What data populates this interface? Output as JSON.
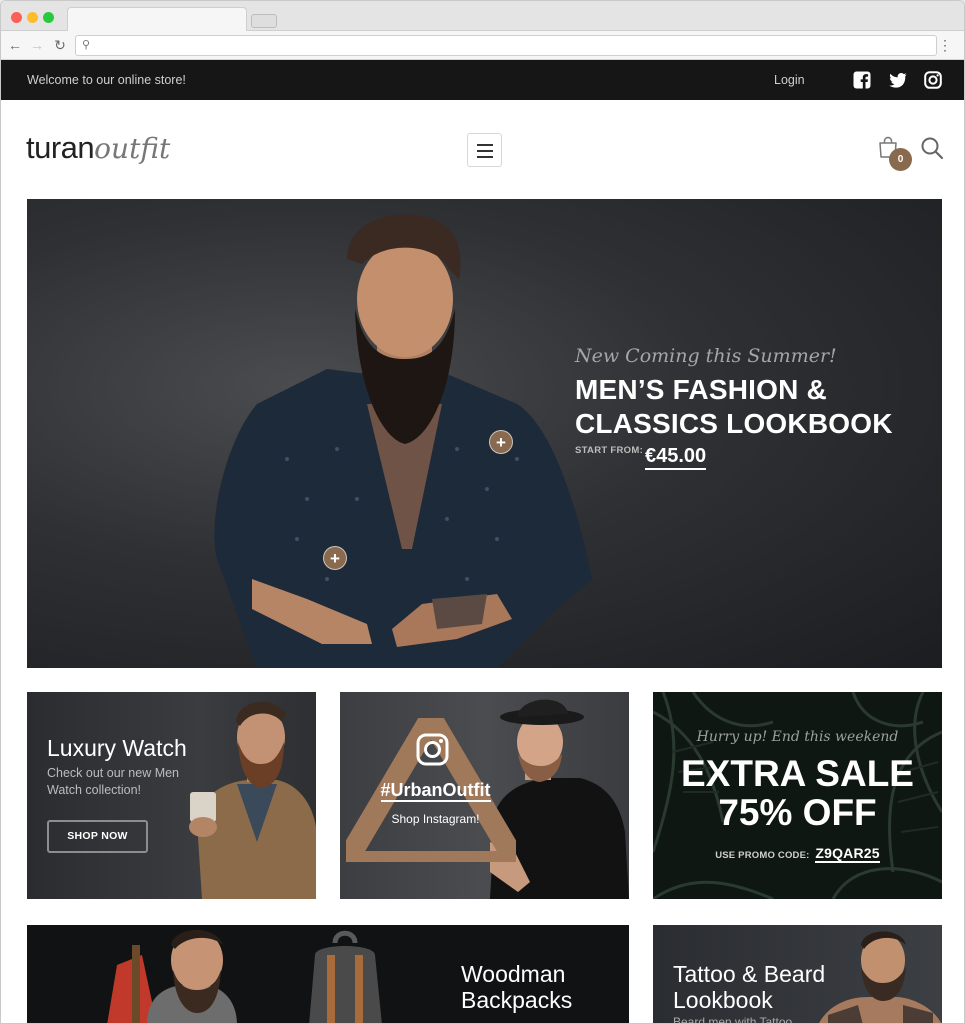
{
  "browser": {
    "omnibox_value": ""
  },
  "topbar": {
    "welcome": "Welcome to our online store!",
    "login": "Login",
    "social": [
      "facebook-icon",
      "twitter-icon",
      "instagram-icon"
    ]
  },
  "header": {
    "logo_part1": "turan",
    "logo_part2": "outfit",
    "cart_count": "0"
  },
  "hero": {
    "subtitle": "New Coming this Summer!",
    "title_line1": "MEN’S FASHION &",
    "title_line2": "CLASSICS LOOKBOOK",
    "start_label": "START FROM:",
    "price": "€45.00"
  },
  "banners": {
    "watch": {
      "title": "Luxury Watch",
      "desc": "Check out our new Men Watch collection!",
      "button": "SHOP NOW"
    },
    "instagram": {
      "tag": "#UrbanOutfit",
      "shop": "Shop Instagram!"
    },
    "sale": {
      "hurry": "Hurry up! End this weekend",
      "line1": "EXTRA SALE",
      "line2": "75% OFF",
      "promo_label": "USE PROMO CODE:",
      "promo_code": "Z9QAR25"
    },
    "backpacks": {
      "line1": "Woodman",
      "line2": "Backpacks"
    },
    "tattoo": {
      "line1": "Tattoo & Beard",
      "line2": "Lookbook",
      "desc": "Beard men with Tattoo"
    }
  },
  "colors": {
    "accent": "#8a6a4f",
    "topbar": "#161616"
  }
}
